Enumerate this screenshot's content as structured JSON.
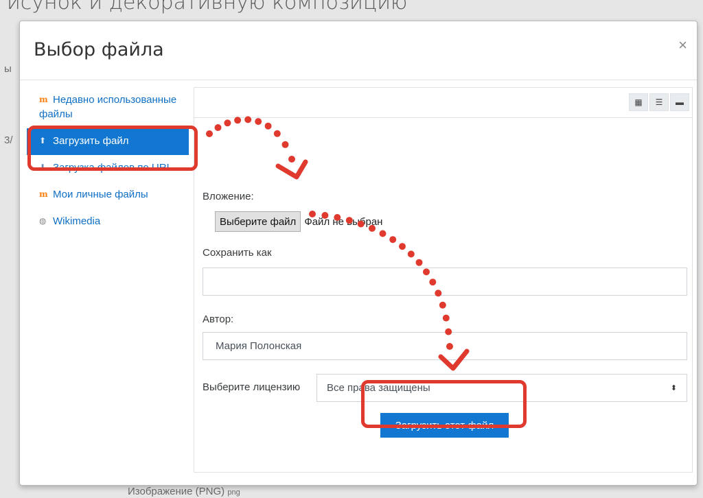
{
  "background": {
    "heading": "исунок и декоративную композицию",
    "frag_1": "ы",
    "frag_2": "3/",
    "footer_text": "Изображение (PNG)",
    "footer_ext": "png"
  },
  "dialog": {
    "title": "Выбор файла",
    "close_glyph": "×"
  },
  "repositories": [
    {
      "label": "Недавно использованные файлы",
      "icon": "moodle-icon",
      "glyph": "m",
      "active": false
    },
    {
      "label": "Загрузить файл",
      "icon": "upload-icon",
      "glyph": "⬆",
      "active": true
    },
    {
      "label": "Загрузка файлов по URL",
      "icon": "url-download-icon",
      "glyph": "⬇",
      "active": false
    },
    {
      "label": "Мои личные файлы",
      "icon": "moodle-icon",
      "glyph": "m",
      "active": false
    },
    {
      "label": "Wikimedia",
      "icon": "wikimedia-icon",
      "glyph": "◍",
      "active": false
    }
  ],
  "toolbar": {
    "grid_view_glyph": "▦",
    "list_view_glyph": "☰",
    "tree_view_glyph": "▬"
  },
  "form": {
    "attachment_label": "Вложение:",
    "choose_file_button": "Выберите файл",
    "file_status": "Файл не выбран",
    "save_as_label": "Сохранить как",
    "save_as_value": "",
    "author_label": "Автор:",
    "author_value": "Мария Полонская",
    "license_label": "Выберите лицензию",
    "license_value": "Все права защищены",
    "license_caret": "⬍",
    "upload_button": "Загрузить этот файл"
  },
  "colors": {
    "accent": "#1177d1",
    "link": "#0f6fc5",
    "annotation": "#e03a2e"
  }
}
